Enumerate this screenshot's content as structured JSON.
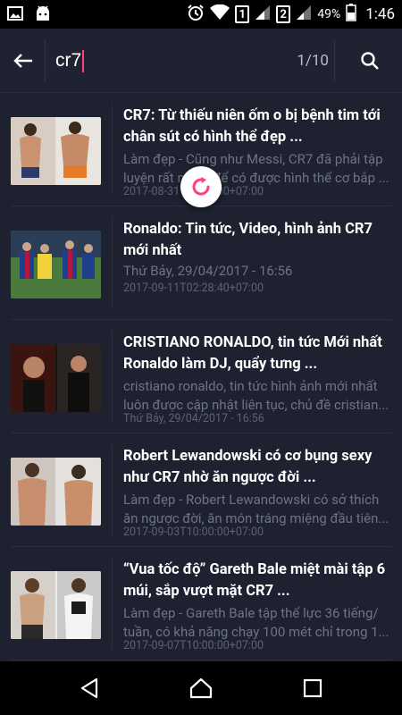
{
  "status_bar": {
    "sim1": "1",
    "sim2": "2",
    "battery": "49%",
    "time": "1:46"
  },
  "search": {
    "value": "cr7",
    "result_counter": "1/10"
  },
  "results": [
    {
      "title": "CR7: Từ thiếu niên ốm o bị bệnh tim tới chân sút có hình thể đẹp ...",
      "description": "Làm đẹp - Cũng như Messi, CR7 đã phải tập luyện rất nhiều để có được hình thể cơ bắp ...",
      "meta": "2017-08-31T10:00:00+07:00"
    },
    {
      "title": "Ronaldo: Tin tức, Video, hình ảnh CR7 mới nhất",
      "description": "Thứ Bảy, 29/04/2017 - 16:56",
      "meta": "2017-09-11T02:28:40+07:00"
    },
    {
      "title": "CRISTIANO RONALDO, tin tức Mới nhất Ronaldo làm DJ, quẩy tưng ...",
      "description": "cristiano ronaldo, tin tức hình ảnh mới nhất luôn được cập nhật liên tục, chủ đề cristian...",
      "meta": "Thứ Bảy, 29/04/2017 - 16:56"
    },
    {
      "title": "Robert Lewandowski có cơ bụng sexy như CR7 nhờ ăn ngược đời ...",
      "description": "Làm đẹp - Robert Lewandowski có sở thích ăn ngược đời, ăn món tráng miệng đầu tiên...",
      "meta": "2017-09-03T10:00:00+07:00"
    },
    {
      "title": "“Vua tốc độ” Gareth Bale miệt mài tập 6 múi, sắp vượt mặt CR7 ...",
      "description": "Làm đẹp - Gareth Bale tập thể lực 36 tiếng/ tuần, có khả năng chạy 100 mét chỉ trong 1...",
      "meta": "2017-09-07T10:00:00+07:00"
    }
  ],
  "colors": {
    "background": "#1e2130",
    "app_bar": "#1f2230",
    "accent": "#ff3d7f",
    "title_text": "#ffffff",
    "muted_text": "#6e7384"
  }
}
